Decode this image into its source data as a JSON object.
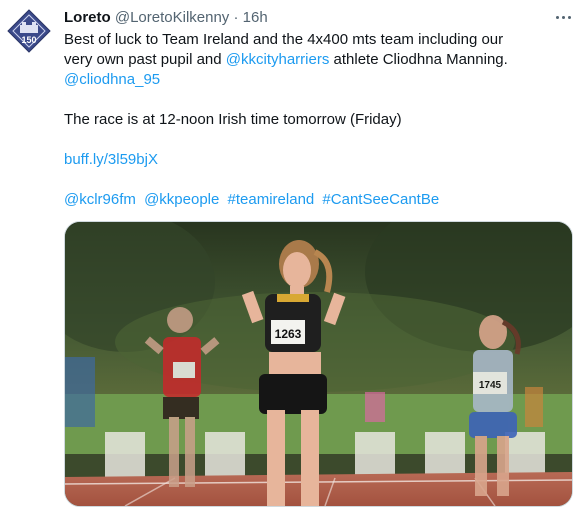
{
  "tweet": {
    "display_name": "Loreto",
    "handle": "@LoretoKilkenny",
    "separator": "·",
    "time": "16h",
    "avatar_text": "150",
    "body": {
      "line1": "Best of luck to Team Ireland and the 4x400 mts team including our",
      "line2_a": "very own past pupil and ",
      "line2_mention": "@kkcityharriers",
      "line2_b": " athlete Cliodhna Manning.",
      "mention2": "@cliodhna_95",
      "line3": "The race is at 12-noon Irish time tomorrow (Friday)",
      "short_link": "buff.ly/3l59bjX",
      "tags": [
        "@kclr96fm",
        "@kkpeople",
        "#teamireland",
        "#CantSeeCantBe"
      ]
    },
    "media": {
      "bib_numbers": [
        "1263",
        "1745"
      ]
    }
  },
  "colors": {
    "link": "#1d9bf0",
    "text": "#0f1419",
    "muted": "#536471",
    "avatar_bg": "#3b4a8a"
  },
  "icons": {
    "more": "more-horizontal-icon",
    "avatar": "loreto-logo"
  }
}
